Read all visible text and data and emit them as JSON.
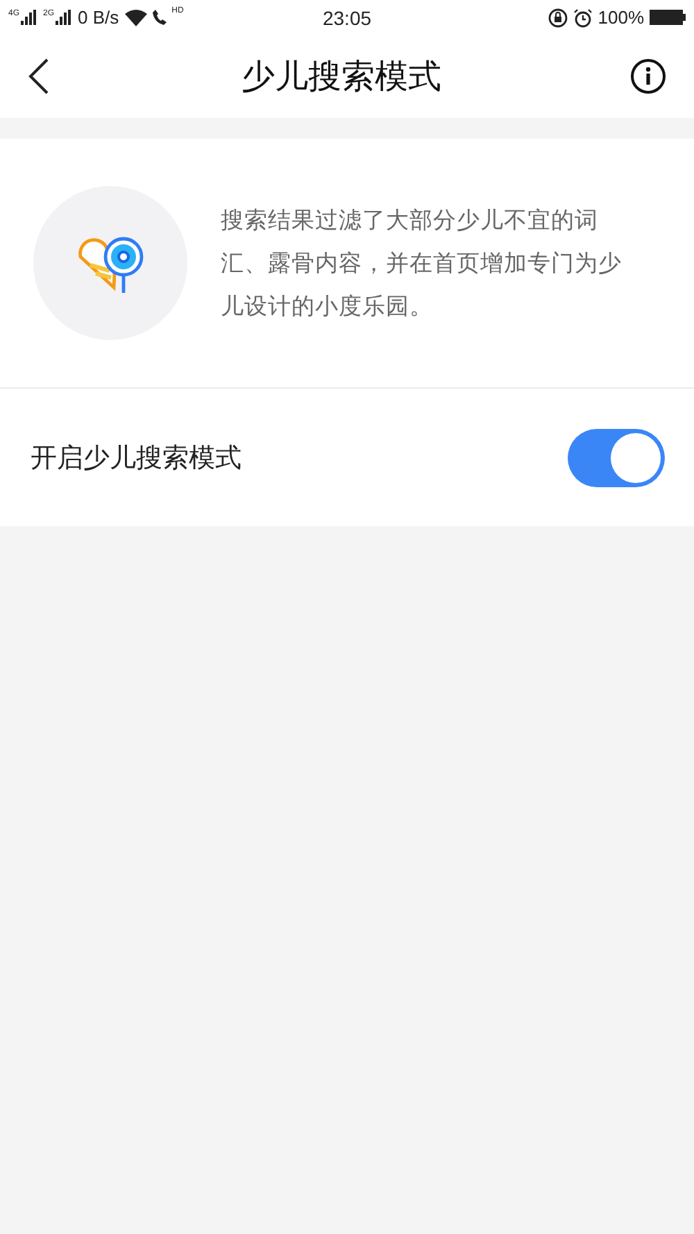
{
  "status_bar": {
    "network_1": "4G",
    "network_2": "2G",
    "speed": "0 B/s",
    "call_badge": "HD",
    "time": "23:05",
    "battery": "100%"
  },
  "header": {
    "title": "少儿搜索模式"
  },
  "intro": {
    "description": "搜索结果过滤了大部分少儿不宜的词汇、露骨内容，并在首页增加专门为少儿设计的小度乐园。"
  },
  "setting": {
    "label": "开启少儿搜索模式",
    "on": true
  }
}
